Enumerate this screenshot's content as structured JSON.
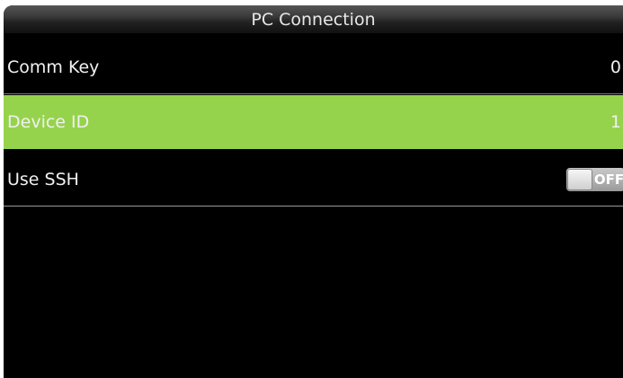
{
  "header": {
    "title": "PC Connection"
  },
  "rows": [
    {
      "label": "Comm Key",
      "value": "0"
    },
    {
      "label": "Device ID",
      "value": "1"
    },
    {
      "label": "Use SSH",
      "toggle": "OFF"
    }
  ],
  "colors": {
    "selected_row": "#96d34c",
    "background": "#000000"
  }
}
